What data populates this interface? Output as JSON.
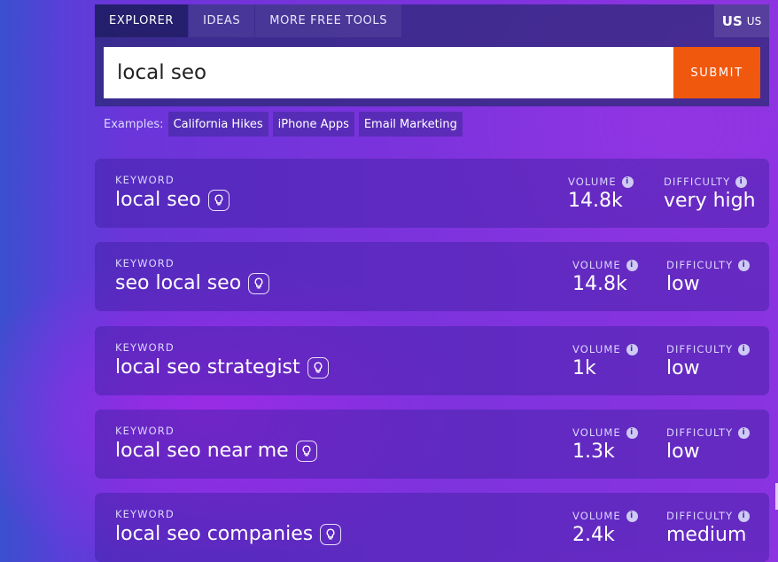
{
  "tabs": [
    {
      "label": "EXPLORER",
      "active": true
    },
    {
      "label": "IDEAS",
      "active": false
    },
    {
      "label": "MORE FREE TOOLS",
      "active": false
    }
  ],
  "country": {
    "code": "US",
    "label": "US"
  },
  "search": {
    "value": "local seo",
    "submit_label": "SUBMIT"
  },
  "examples": {
    "label": "Examples:",
    "items": [
      "California Hikes",
      "iPhone Apps",
      "Email Marketing"
    ]
  },
  "result_labels": {
    "keyword": "KEYWORD",
    "volume": "VOLUME",
    "difficulty": "DIFFICULTY"
  },
  "results": [
    {
      "keyword": "local seo",
      "volume": "14.8k",
      "difficulty": "very high"
    },
    {
      "keyword": "seo local seo",
      "volume": "14.8k",
      "difficulty": "low"
    },
    {
      "keyword": "local seo strategist",
      "volume": "1k",
      "difficulty": "low"
    },
    {
      "keyword": "local seo near me",
      "volume": "1.3k",
      "difficulty": "low"
    },
    {
      "keyword": "local seo companies",
      "volume": "2.4k",
      "difficulty": "medium"
    }
  ],
  "colors": {
    "submit": "#f0580e",
    "accent_bg": "#7a33dc"
  }
}
